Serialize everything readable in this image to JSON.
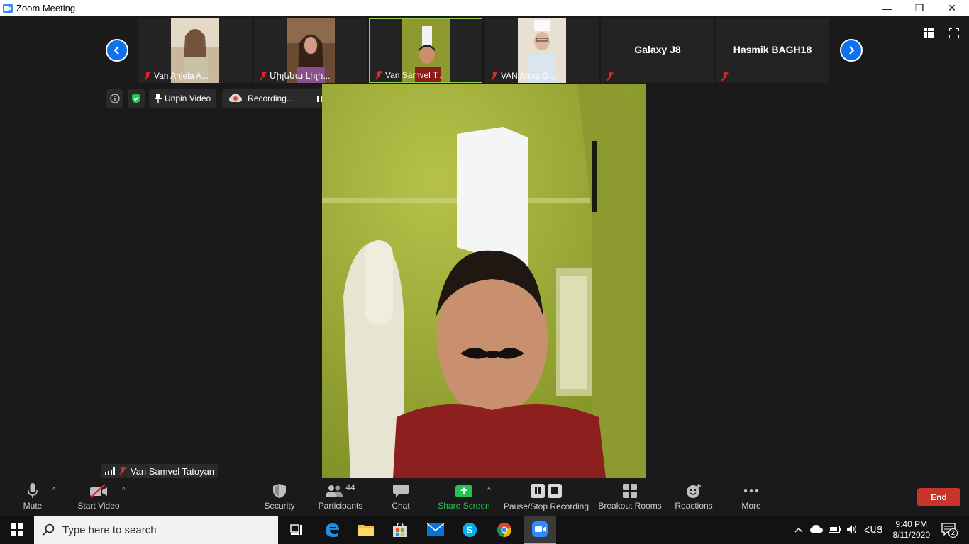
{
  "window": {
    "title": "Zoom Meeting",
    "minimize": "—",
    "restore": "❐",
    "close": "✕"
  },
  "gallery": {
    "participants": [
      {
        "name": "Van Anjela A..."
      },
      {
        "name": "Միլենա Լիլի..."
      },
      {
        "name": "Van Samvel T...",
        "active": true
      },
      {
        "name": "VAN Anna O..."
      },
      {
        "name": "",
        "display_name": "Galaxy J8"
      },
      {
        "name": "",
        "display_name": "Hasmik BAGH18"
      }
    ]
  },
  "info_bar": {
    "unpin_label": "Unpin Video",
    "recording_label": "Recording..."
  },
  "active_speaker": {
    "name": "Van Samvel Tatoyan"
  },
  "toolbar": {
    "mute": "Mute",
    "start_video": "Start Video",
    "security": "Security",
    "participants": "Participants",
    "participants_count": "44",
    "chat": "Chat",
    "share_screen": "Share Screen",
    "pause_stop_recording": "Pause/Stop Recording",
    "breakout_rooms": "Breakout Rooms",
    "reactions": "Reactions",
    "more": "More",
    "end": "End"
  },
  "taskbar": {
    "search_placeholder": "Type here to search",
    "language": "ՀԱՅ",
    "time": "9:40 PM",
    "date": "8/11/2020",
    "notification_count": "2"
  },
  "colors": {
    "accent": "#0e72ed",
    "share_green": "#23c552",
    "end_red": "#c8332a",
    "active_border": "#8fd14f"
  }
}
